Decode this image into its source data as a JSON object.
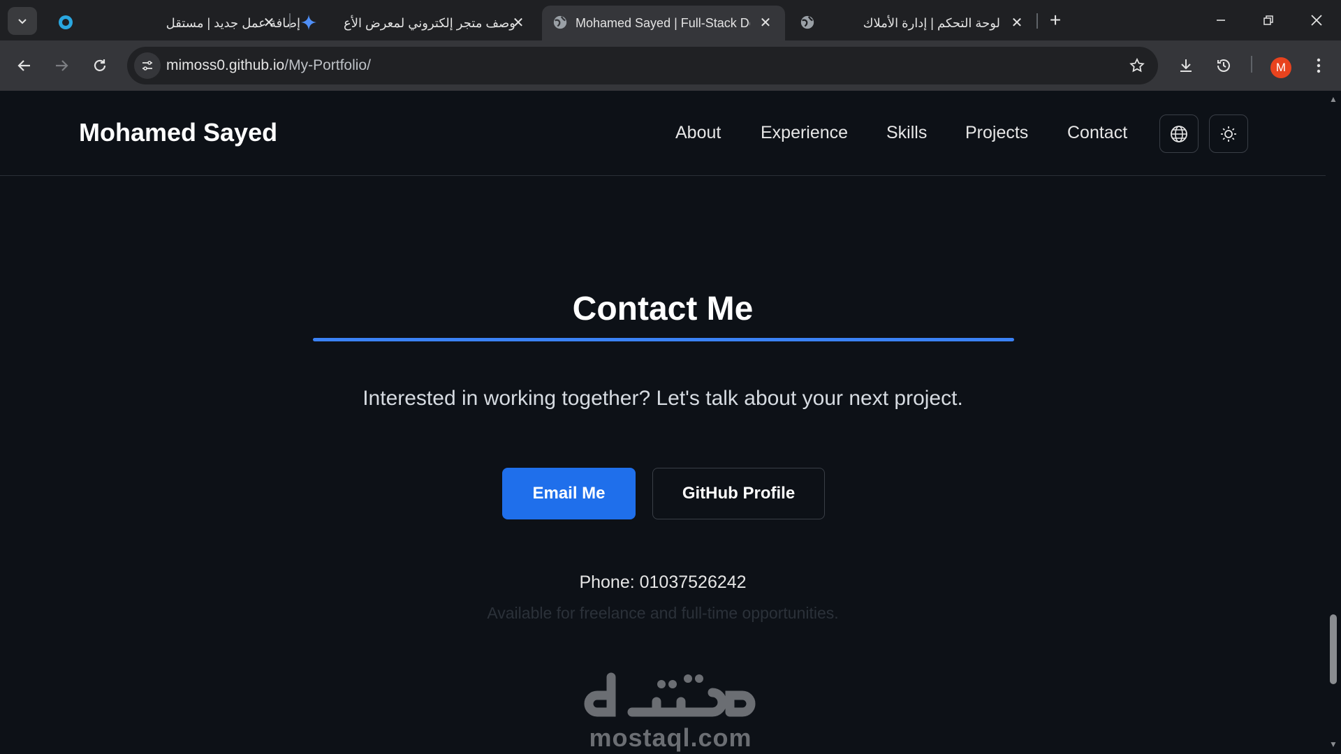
{
  "browser": {
    "tabs": [
      {
        "title": "إضافة عمل جديد | مستقل",
        "favicon": "mostaql-icon",
        "active": false
      },
      {
        "title": "وصف متجر إلكتروني لمعرض الأع",
        "favicon": "gemini-sparkle-icon",
        "active": false
      },
      {
        "title": "Mohamed Sayed | Full-Stack De",
        "favicon": "globe-icon",
        "active": true
      },
      {
        "title": "لوحة التحكم | إدارة الأملاك",
        "favicon": "globe-icon",
        "active": false
      }
    ],
    "new_tab_label": "+",
    "url_host": "mimoss0.github.io",
    "url_path": "/My-Portfolio/",
    "avatar_letter": "M",
    "avatar_color": "#e8431e"
  },
  "site": {
    "brand": "Mohamed Sayed",
    "nav": [
      "About",
      "Experience",
      "Skills",
      "Projects",
      "Contact"
    ],
    "contact": {
      "title": "Contact Me",
      "subtitle": "Interested in working together? Let's talk about your next project.",
      "email_button": "Email Me",
      "github_button": "GitHub Profile",
      "phone": "Phone: 01037526242",
      "availability": "Available for freelance and full-time opportunities."
    },
    "accent_color": "#3b82f6"
  },
  "watermark": {
    "domain": "mostaql.com"
  }
}
